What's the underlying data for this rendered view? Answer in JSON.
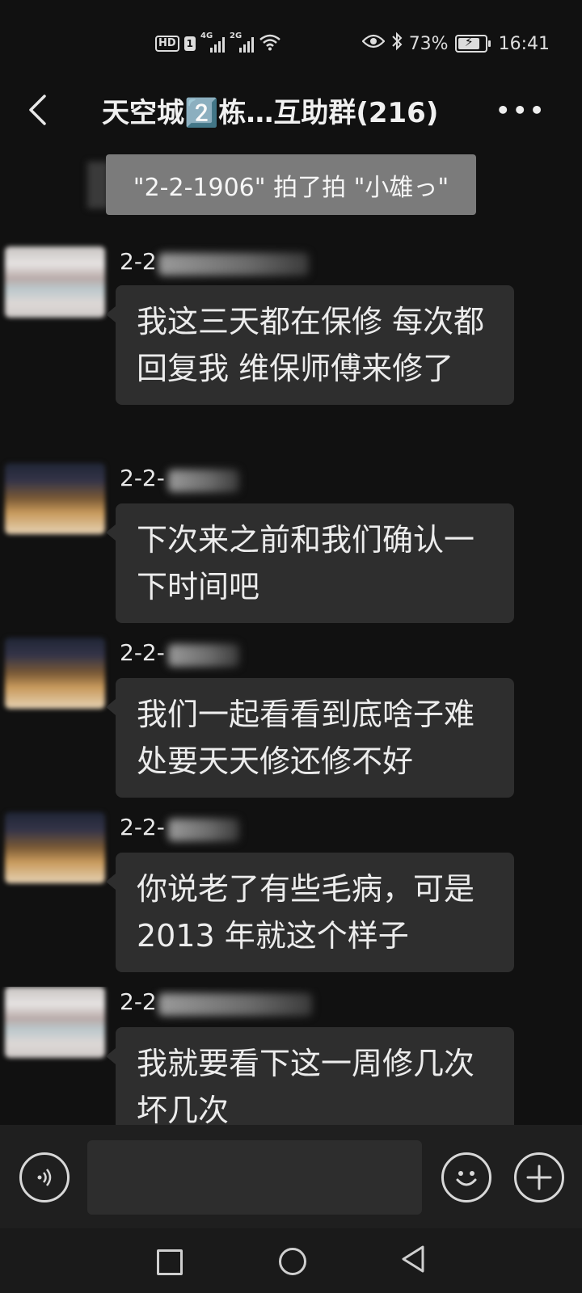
{
  "status_bar": {
    "hd_label": "HD",
    "sim_label": "1",
    "network1": "4G",
    "network2": "2G",
    "battery_percent": "73%",
    "battery_level": 0.73,
    "time": "16:41"
  },
  "header": {
    "title": "天空城2️⃣栋…互助群(216)"
  },
  "system_message": {
    "text": "\"2-2-1906\" 拍了拍 \"小雄っ\""
  },
  "messages": [
    {
      "sender": "2-2",
      "avatar": "avatar-light",
      "text": "我这三天都在保修 每次都回复我 维保师傅来修了"
    },
    {
      "sender": "2-2-",
      "avatar": "avatar-dark",
      "text": "下次来之前和我们确认一下时间吧"
    },
    {
      "sender": "2-2-",
      "avatar": "avatar-dark",
      "text": "我们一起看看到底啥子难处要天天修还修不好"
    },
    {
      "sender": "2-2-",
      "avatar": "avatar-dark",
      "text": "你说老了有些毛病，可是2013 年就这个样子"
    },
    {
      "sender": "2-2",
      "avatar": "avatar-light",
      "text": "我就要看下这一周修几次 坏几次"
    }
  ],
  "input_bar": {
    "voice_icon": "voice-icon",
    "emoji_icon": "emoji-icon",
    "plus_icon": "plus-icon",
    "placeholder": ""
  },
  "nav_bar": {
    "icons": [
      "square-icon",
      "circle-icon",
      "triangle-back-icon"
    ]
  }
}
